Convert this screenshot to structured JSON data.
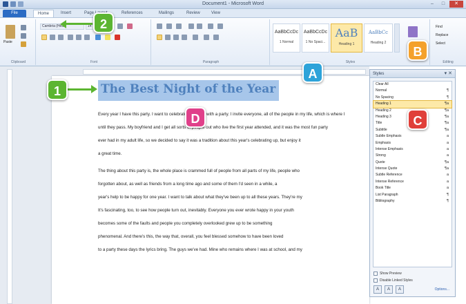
{
  "window": {
    "title": "Document1 - Microsoft Word",
    "controls": [
      "–",
      "□",
      "✕"
    ]
  },
  "tabs": {
    "file": "File",
    "home": "Home",
    "insert": "Insert",
    "page_layout": "Page Layout",
    "references": "References",
    "mailings": "Mailings",
    "review": "Review",
    "view": "View"
  },
  "ribbon": {
    "clipboard": {
      "label": "Clipboard",
      "paste": "Paste"
    },
    "font": {
      "label": "Font",
      "font_name": "Cambria (Headi",
      "font_size": "14"
    },
    "paragraph": {
      "label": "Paragraph"
    },
    "styles": {
      "label": "Styles",
      "gallery": [
        {
          "sample": "AaBbCcDc",
          "name": "1 Normal"
        },
        {
          "sample": "AaBbCcDc",
          "name": "1 No Spaci..."
        },
        {
          "sample": "AaB",
          "name": "Heading 1"
        },
        {
          "sample": "AaBbCc",
          "name": "Heading 2"
        }
      ],
      "change_styles": "Change Styles"
    },
    "editing": {
      "label": "Editing",
      "find": "Find",
      "replace": "Replace",
      "select": "Select"
    }
  },
  "document": {
    "heading": "The Best Night of the Year",
    "paragraphs": [
      [
        "Every year I have this party. I want to celebrate my youth with a party. I invite everyone, all of the people in my life, which is where I",
        "until they pass. My boyfriend and I get all sorts of people out who live the first year attended, and it was the most fun party",
        "ever had in my adult life, so we decided to say it was a tradition about this year's celebrating up, but enjoy it",
        "a great time."
      ],
      [
        "The thing about this party is, the whole place is crammed full of people from all parts of my life, people who",
        "forgotten about, as well as friends from a long time ago and some of them I'd seen in a while, a",
        "year's help to be happy for one year. I want to talk about what they've been up to all these years. They're my",
        "It's fascinating, too, to see how people turn out, inevitably. Everyone you ever wrote happy in your youth",
        "becomes some of the faults and people you completely overlooked grew up to be something",
        "phenomenal. And there's this, the way that, overall, you feel blessed somehow to have been loved",
        "to a party these days the lyrics bring. The guys we've had. Mine who remains where I was at school, and my"
      ]
    ]
  },
  "styles_pane": {
    "title": "Styles",
    "items": [
      {
        "name": "Clear All",
        "mark": ""
      },
      {
        "name": "Normal",
        "mark": "¶"
      },
      {
        "name": "No Spacing",
        "mark": "¶"
      },
      {
        "name": "Heading 1",
        "mark": "¶a"
      },
      {
        "name": "Heading 2",
        "mark": "¶a"
      },
      {
        "name": "Heading 3",
        "mark": "¶a"
      },
      {
        "name": "Title",
        "mark": "¶a"
      },
      {
        "name": "Subtitle",
        "mark": "¶a"
      },
      {
        "name": "Subtle Emphasis",
        "mark": "a"
      },
      {
        "name": "Emphasis",
        "mark": "a"
      },
      {
        "name": "Intense Emphasis",
        "mark": "a"
      },
      {
        "name": "Strong",
        "mark": "a"
      },
      {
        "name": "Quote",
        "mark": "¶a"
      },
      {
        "name": "Intense Quote",
        "mark": "¶a"
      },
      {
        "name": "Subtle Reference",
        "mark": "a"
      },
      {
        "name": "Intense Reference",
        "mark": "a"
      },
      {
        "name": "Book Title",
        "mark": "a"
      },
      {
        "name": "List Paragraph",
        "mark": "¶"
      },
      {
        "name": "Bibliography",
        "mark": "¶"
      }
    ],
    "selected_index": 3,
    "show_preview": "Show Preview",
    "disable_linked": "Disable Linked Styles",
    "options": "Options..."
  },
  "callouts": [
    {
      "label": "1",
      "color": "#5cb531"
    },
    {
      "label": "2",
      "color": "#5cb531"
    },
    {
      "label": "A",
      "color": "#2da3d9"
    },
    {
      "label": "B",
      "color": "#f4a12b"
    },
    {
      "label": "C",
      "color": "#e0403a"
    },
    {
      "label": "D",
      "color": "#e0408a"
    }
  ]
}
